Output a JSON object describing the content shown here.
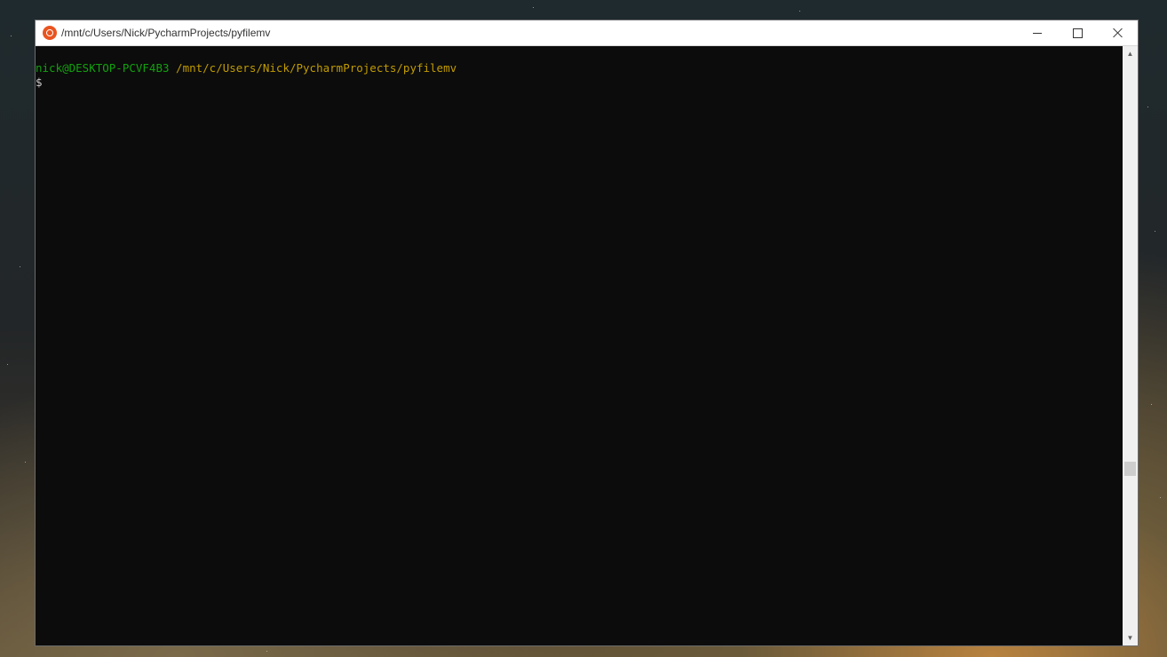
{
  "window": {
    "title": "/mnt/c/Users/Nick/PycharmProjects/pyfilemv",
    "icon": "ubuntu-icon",
    "controls": {
      "minimize": "minimize-icon",
      "maximize": "maximize-icon",
      "close": "close-icon"
    }
  },
  "terminal": {
    "user_host": "nick@DESKTOP-PCVF4B3",
    "cwd": "/mnt/c/Users/Nick/PycharmProjects/pyfilemv",
    "prompt_symbol": "$",
    "colors": {
      "background": "#0c0c0c",
      "user_host": "#13a10e",
      "cwd": "#c19c00",
      "text": "#cccccc"
    }
  },
  "scrollbar": {
    "up_glyph": "▲",
    "down_glyph": "▼"
  }
}
